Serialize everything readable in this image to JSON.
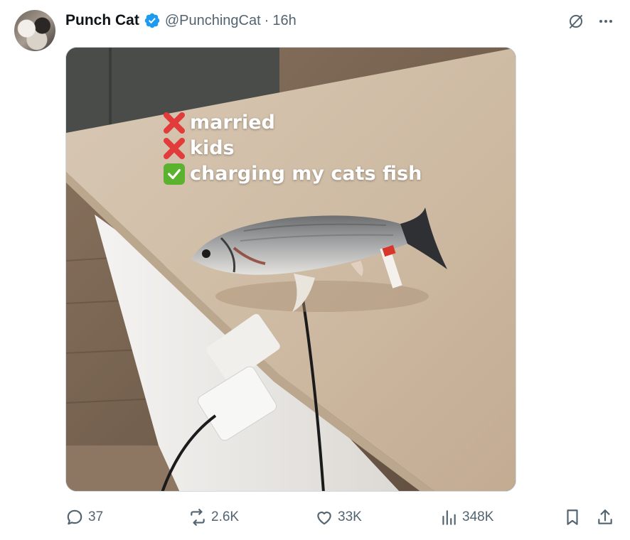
{
  "post": {
    "author_name": "Punch Cat",
    "handle": "@PunchingCat",
    "separator": "·",
    "time": "16h"
  },
  "media": {
    "caption_lines": [
      {
        "mark": "cross",
        "text": "married"
      },
      {
        "mark": "cross",
        "text": "kids"
      },
      {
        "mark": "check",
        "text": "charging my cats fish"
      }
    ]
  },
  "actions": {
    "replies": "37",
    "reposts": "2.6K",
    "likes": "33K",
    "views": "348K"
  },
  "icons": {
    "verified": "verified-badge-icon",
    "grok": "grok-icon",
    "more": "more-icon",
    "reply": "reply-icon",
    "repost": "repost-icon",
    "like": "heart-icon",
    "views": "views-icon",
    "bookmark": "bookmark-icon",
    "share": "share-icon"
  },
  "colors": {
    "verified": "#1d9bf0",
    "muted": "#536471",
    "text": "#0f1419",
    "cross": "#e23b3b",
    "check": "#5ab22e"
  }
}
